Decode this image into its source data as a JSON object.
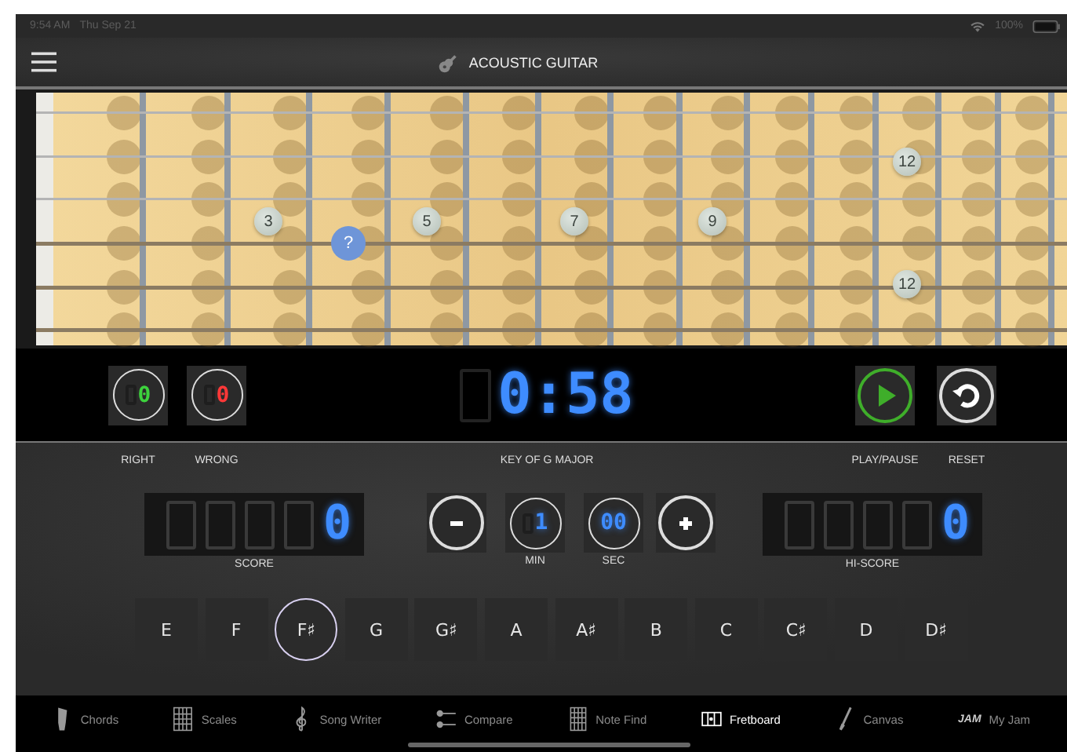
{
  "status_bar": {
    "time": "9:54 AM",
    "date": "Thu Sep 21",
    "battery": "100%"
  },
  "nav": {
    "title": "ACOUSTIC GUITAR"
  },
  "fretboard": {
    "inlays": [
      {
        "label": "3"
      },
      {
        "label": "5"
      },
      {
        "label": "7"
      },
      {
        "label": "9"
      },
      {
        "label": "12"
      },
      {
        "label": "12"
      }
    ],
    "question_marker": {
      "label": "?"
    }
  },
  "counters": [
    {
      "kind": "right",
      "label": "RIGHT",
      "count": "0"
    },
    {
      "kind": "wrong",
      "label": "WRONG",
      "count": "0"
    }
  ],
  "timer": {
    "value": "0:58",
    "caption": "KEY OF G MAJOR"
  },
  "controls": [
    {
      "kind": "play",
      "label": "PLAY/PAUSE"
    },
    {
      "kind": "reset",
      "label": "RESET"
    }
  ],
  "score": {
    "label": "SCORE",
    "value": "0"
  },
  "time_setting": {
    "min_label": "MIN",
    "min": "1",
    "sec_label": "SEC",
    "sec": "00"
  },
  "hi_score": {
    "label": "HI-SCORE",
    "value": "0"
  },
  "notes": [
    {
      "label": "E",
      "selected": false
    },
    {
      "label": "F",
      "selected": false
    },
    {
      "label": "F♯",
      "selected": true
    },
    {
      "label": "G",
      "selected": false
    },
    {
      "label": "G♯",
      "selected": false
    },
    {
      "label": "A",
      "selected": false
    },
    {
      "label": "A♯",
      "selected": false
    },
    {
      "label": "B",
      "selected": false
    },
    {
      "label": "C",
      "selected": false
    },
    {
      "label": "C♯",
      "selected": false
    },
    {
      "label": "D",
      "selected": false
    },
    {
      "label": "D♯",
      "selected": false
    }
  ],
  "tabs": [
    {
      "kind": "chords",
      "label": "Chords",
      "selected": false
    },
    {
      "kind": "scales",
      "label": "Scales",
      "selected": false
    },
    {
      "kind": "songwriter",
      "label": "Song Writer",
      "selected": false
    },
    {
      "kind": "compare",
      "label": "Compare",
      "selected": false
    },
    {
      "kind": "notefind",
      "label": "Note Find",
      "selected": false
    },
    {
      "kind": "fretboard",
      "label": "Fretboard",
      "selected": true
    },
    {
      "kind": "canvas",
      "label": "Canvas",
      "selected": false
    },
    {
      "kind": "jam",
      "label": "My Jam",
      "logo": "JAM",
      "selected": false
    }
  ]
}
